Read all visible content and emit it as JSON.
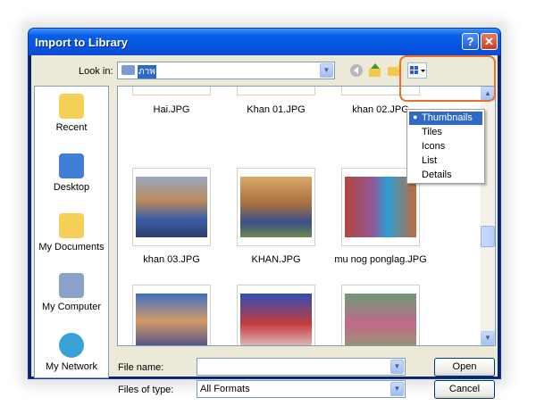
{
  "window": {
    "title": "Import to Library",
    "help_label": "?",
    "close_label": "✕"
  },
  "look_in": {
    "label": "Look in:",
    "value": "ภาพ"
  },
  "places": [
    {
      "label": "Recent",
      "icon": "recent-folder-icon"
    },
    {
      "label": "Desktop",
      "icon": "desktop-icon"
    },
    {
      "label": "My Documents",
      "icon": "my-documents-icon"
    },
    {
      "label": "My Computer",
      "icon": "my-computer-icon"
    },
    {
      "label": "My Network",
      "icon": "my-network-icon"
    }
  ],
  "files": {
    "row1": [
      "Hai.JPG",
      "Khan 01.JPG",
      "khan 02.JPG"
    ],
    "row2": [
      "khan 03.JPG",
      "KHAN.JPG",
      "mu nog ponglag.JPG"
    ]
  },
  "view_menu": {
    "items": [
      "Thumbnails",
      "Tiles",
      "Icons",
      "List",
      "Details"
    ],
    "selected": "Thumbnails"
  },
  "file_name": {
    "label": "File name:",
    "value": ""
  },
  "files_of_type": {
    "label": "Files of type:",
    "value": "All Formats"
  },
  "buttons": {
    "open": "Open",
    "cancel": "Cancel"
  },
  "colors": {
    "titlebar": "#0554e0",
    "selection": "#316ac5",
    "highlight_ring": "#e8702a"
  }
}
